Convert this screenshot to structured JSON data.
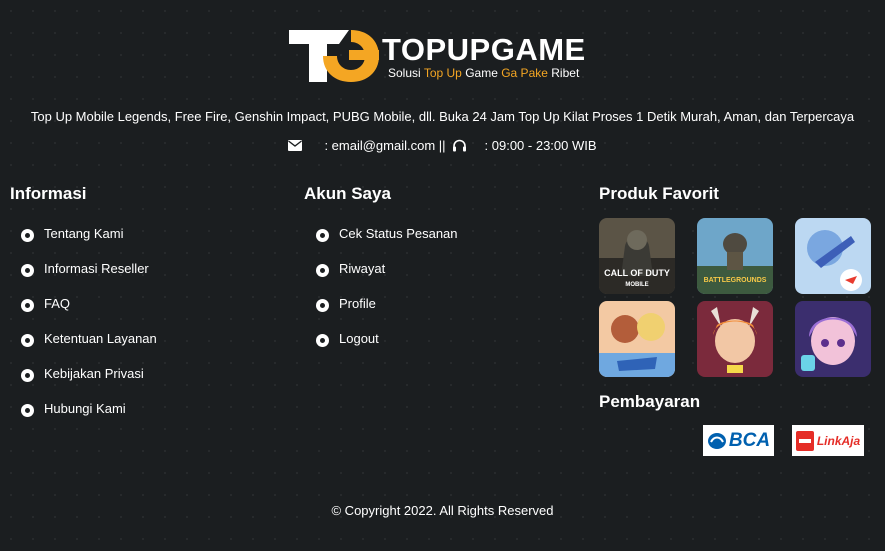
{
  "brand": {
    "word_part1": "TOPUP",
    "word_part2": "GAME",
    "tag_part1": "Solusi",
    "tag_part2": "Top Up",
    "tag_part3": "Game",
    "tag_part4": "Ga Pake",
    "tag_part5": "Ribet",
    "accent_color": "#f4a623"
  },
  "tagline": "Top Up Mobile Legends, Free Fire, Genshin Impact, PUBG Mobile, dll. Buka 24 Jam Top Up Kilat Proses 1 Detik Murah, Aman, dan Terpercaya",
  "contact": {
    "email_text": ": email@gmail.com ||",
    "hours_text": ": 09:00 - 23:00 WIB",
    "email_icon": "envelope-icon",
    "hours_icon": "headphones-icon"
  },
  "informasi": {
    "title": "Informasi",
    "items": [
      "Tentang Kami",
      "Informasi Reseller",
      "FAQ",
      "Ketentuan Layanan",
      "Kebijakan Privasi",
      "Hubungi Kami"
    ]
  },
  "akun": {
    "title": "Akun Saya",
    "items": [
      "Cek Status Pesanan",
      "Riwayat",
      "Profile",
      "Logout"
    ]
  },
  "produk": {
    "title": "Produk Favorit",
    "items": [
      {
        "label": "CALL OF DUTY",
        "sub": "MOBILE"
      },
      {
        "label": "BATTLEGROUNDS",
        "sub": ""
      },
      {
        "label": "",
        "sub": ""
      },
      {
        "label": "",
        "sub": ""
      },
      {
        "label": "",
        "sub": ""
      },
      {
        "label": "",
        "sub": ""
      }
    ]
  },
  "pembayaran": {
    "title": "Pembayaran",
    "bca_label": "BCA",
    "linkaja_label": "LinkAja"
  },
  "copyright": "© Copyright 2022. All Rights Reserved"
}
